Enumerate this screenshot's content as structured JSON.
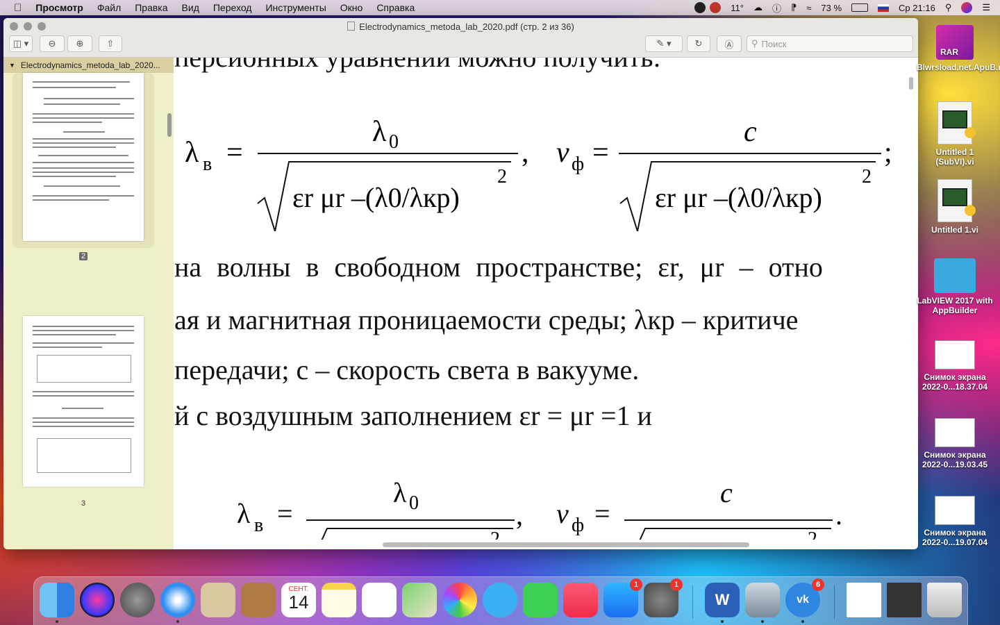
{
  "menubar": {
    "apple": "",
    "app": "Просмотр",
    "items": [
      "Файл",
      "Правка",
      "Вид",
      "Переход",
      "Инструменты",
      "Окно",
      "Справка"
    ],
    "temperature": "11°",
    "battery": "73 %",
    "clock": "Ср 21:16"
  },
  "window": {
    "title": "Electrodynamics_metoda_lab_2020.pdf (стр. 2 из 36)",
    "search_placeholder": "Поиск"
  },
  "sidebar": {
    "file_label": "Electrodynamics_metoda_lab_2020...",
    "pages": [
      {
        "number": "2",
        "selected": true
      },
      {
        "number": "3",
        "selected": false
      }
    ]
  },
  "document": {
    "top_line": "персионных уравнений можно получить:",
    "line1": "на волны в свободном пространстве; εr, μr – отно",
    "line2": "ая и магнитная проницаемости среды; λкр – критиче",
    "line3": "передачи; c – скорость света в вакууме.",
    "line4": "й с воздушным заполнением εr = μr =1 и"
  },
  "desktop": {
    "icons": [
      {
        "label": "Blwrsload.net.ApuB.rar"
      },
      {
        "label": "Untitled 1 (SubVI).vi"
      },
      {
        "label": "Untitled 1.vi"
      },
      {
        "label": "LabVIEW 2017 with AppBuilder"
      },
      {
        "label": "Снимок экрана 2022-0...18.37.04"
      },
      {
        "label": "Снимок экрана 2022-0...19.03.45"
      },
      {
        "label": "Снимок экрана 2022-0...19.07.04"
      }
    ]
  },
  "dock": {
    "calendar_month": "СЕНТ.",
    "calendar_day": "14",
    "badges": {
      "appstore": "1",
      "settings": "1",
      "vk": "6"
    }
  }
}
